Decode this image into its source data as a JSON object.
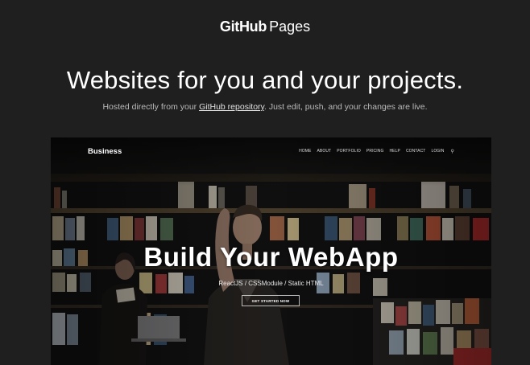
{
  "header": {
    "logo_github": "GitHub",
    "logo_pages": "Pages",
    "headline": "Websites for you and your projects.",
    "sub_before": "Hosted directly from your ",
    "sub_link": "GitHub repository",
    "sub_after": ". Just edit, push, and your changes are live."
  },
  "preview": {
    "brand": "Business",
    "nav": [
      "HOME",
      "ABOUT",
      "PORTFOLIO",
      "PRICING",
      "HELP",
      "CONTACT",
      "LOGIN"
    ],
    "hero_title": "Build Your WebApp",
    "hero_subtitle": "ReactJS / CSSModule / Static HTML",
    "cta_label": "GET STARTED NOW"
  },
  "colors": {
    "page_background": "#1f1f1f",
    "text_primary": "#ffffff",
    "text_secondary": "#b9b9b9"
  },
  "icons": {
    "search": "search-icon"
  }
}
